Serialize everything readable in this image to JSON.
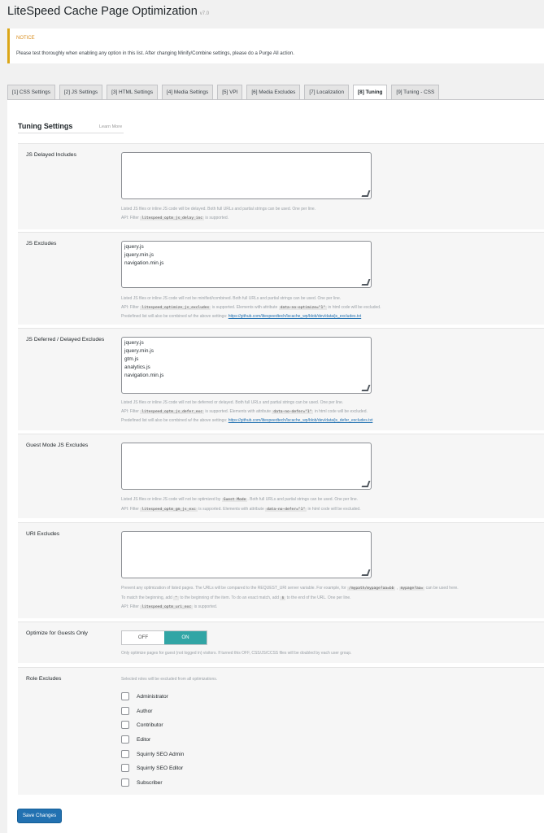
{
  "page": {
    "title": "LiteSpeed Cache Page Optimization",
    "version": "v7.0"
  },
  "notice": {
    "title": "NOTICE",
    "text": "Please test thoroughly when enabling any option in this list. After changing Minify/Combine settings, please do a Purge All action."
  },
  "tabs": [
    {
      "label": "[1] CSS Settings",
      "active": false
    },
    {
      "label": "[2] JS Settings",
      "active": false
    },
    {
      "label": "[3] HTML Settings",
      "active": false
    },
    {
      "label": "[4] Media Settings",
      "active": false
    },
    {
      "label": "[5] VPI",
      "active": false
    },
    {
      "label": "[6] Media Excludes",
      "active": false
    },
    {
      "label": "[7] Localization",
      "active": false
    },
    {
      "label": "[8] Tuning",
      "active": true
    },
    {
      "label": "[9] Tuning - CSS",
      "active": false
    }
  ],
  "section": {
    "title": "Tuning Settings",
    "learn_more": "Learn More"
  },
  "settings": {
    "js_delayed": {
      "label": "JS Delayed Includes",
      "value": "",
      "desc1": "Listed JS files or inline JS code will be delayed. Both full URLs and partial strings can be used. One per line.",
      "desc2_pre": "API: Filter",
      "desc2_code": "litespeed_optm_js_delay_inc",
      "desc2_post": "is supported."
    },
    "js_excludes": {
      "label": "JS Excludes",
      "value": "jquery.js\njquery.min.js\nnavigation.min.js",
      "desc1": "Listed JS files or inline JS code will not be minified/combined. Both full URLs and partial strings can be used. One per line.",
      "desc2_pre": "API: Filter",
      "desc2_code": "litespeed_optimize_js_excludes",
      "desc2_mid": "is supported. Elements with attribute",
      "desc2_code2": "data-no-optimize=\"1\"",
      "desc2_post": "in html code will be excluded.",
      "desc3_pre": "Predefined list will also be combined w/ the above settings:",
      "desc3_link": "https://github.com/litespeedtech/lscache_wp/blob/dev/data/js_excludes.txt"
    },
    "js_deferred": {
      "label": "JS Deferred / Delayed Excludes",
      "value": "jquery.js\njquery.min.js\ngtm.js\nanalytics.js\nnavigation.min.js",
      "desc1": "Listed JS files or inline JS code will not be deferred or delayed. Both full URLs and partial strings can be used. One per line.",
      "desc2_pre": "API: Filter",
      "desc2_code": "litespeed_optm_js_defer_exc",
      "desc2_mid": "is supported. Elements with attribute",
      "desc2_code2": "data-no-defer=\"1\"",
      "desc2_post": "in html code will be excluded.",
      "desc3_pre": "Predefined list will also be combined w/ the above settings:",
      "desc3_link": "https://github.com/litespeedtech/lscache_wp/blob/dev/data/js_defer_excludes.txt"
    },
    "guest_mode": {
      "label": "Guest Mode JS Excludes",
      "value": "",
      "desc1_pre": "Listed JS files or inline JS code will not be optimized by",
      "desc1_code": "Guest Mode",
      "desc1_post": ". Both full URLs and partial strings can be used. One per line.",
      "desc2_pre": "API: Filter",
      "desc2_code": "litespeed_optm_gm_js_exc",
      "desc2_mid": "is supported. Elements with attribute",
      "desc2_code2": "data-no-defer=\"1\"",
      "desc2_post": "in html code will be excluded."
    },
    "uri_excludes": {
      "label": "URI Excludes",
      "value": "",
      "desc1_pre": "Prevent any optimization of listed pages. The URLs will be compared to the REQUEST_URI server variable. For example, for",
      "desc1_code": "/mypath/mypage?aa=bb",
      "desc1_code2": "mypage?aa=",
      "desc1_post": "can be used here.",
      "desc2_pre": "To match the beginning, add",
      "desc2_code": "^",
      "desc2_mid": "to the beginning of the item. To do an exact match, add",
      "desc2_code2": "$",
      "desc2_post": "to the end of the URL. One per line.",
      "desc3_pre": "API: Filter",
      "desc3_code": "litespeed_optm_uri_exc",
      "desc3_post": "is supported."
    },
    "guests_only": {
      "label": "Optimize for Guests Only",
      "off": "OFF",
      "on": "ON",
      "state": "on",
      "desc": "Only optimize pages for guest (not logged in) visitors. If turned this OFF, CSS/JS/CCSS files will be doubled by each user group."
    },
    "role_excludes": {
      "label": "Role Excludes",
      "desc": "Selected roles will be excluded from all optimizations.",
      "roles": [
        {
          "label": "Administrator",
          "checked": false
        },
        {
          "label": "Author",
          "checked": false
        },
        {
          "label": "Contributor",
          "checked": false
        },
        {
          "label": "Editor",
          "checked": false
        },
        {
          "label": "Squirrly SEO Admin",
          "checked": false
        },
        {
          "label": "Squirrly SEO Editor",
          "checked": false
        },
        {
          "label": "Subscriber",
          "checked": false
        }
      ]
    }
  },
  "save_label": "Save Changes"
}
